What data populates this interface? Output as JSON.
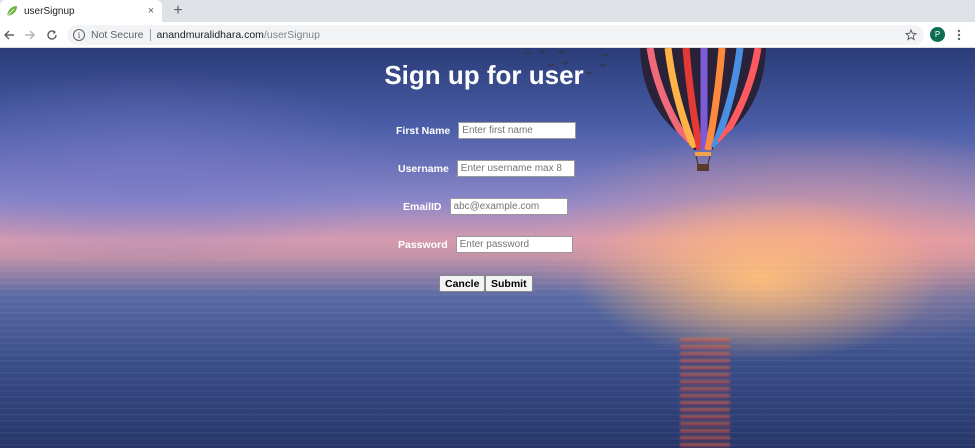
{
  "browser": {
    "tab_title": "userSignup",
    "tab_close": "×",
    "new_tab": "+",
    "security_text": "Not Secure",
    "url_host": "anandmuralidhara.com",
    "url_path": "/userSignup",
    "profile_initial": "P",
    "icons": {
      "back": "back-arrow-icon",
      "forward": "forward-arrow-icon",
      "reload": "reload-icon",
      "info": "info-icon",
      "bookmark": "star-icon",
      "menu": "kebab-menu-icon",
      "favicon": "leaf-icon"
    }
  },
  "page": {
    "heading": "Sign up for user",
    "fields": [
      {
        "label": "First Name",
        "placeholder": "Enter first name",
        "value": ""
      },
      {
        "label": "Username",
        "placeholder": "Enter username max 8",
        "value": ""
      },
      {
        "label": "EmailID",
        "placeholder": "abc@example.com",
        "value": ""
      },
      {
        "label": "Password",
        "placeholder": "Enter password",
        "value": ""
      }
    ],
    "buttons": {
      "cancel": "Cancle",
      "submit": "Submit"
    }
  },
  "colors": {
    "profile_bg": "#0b6e52",
    "heading": "#ffffff"
  }
}
